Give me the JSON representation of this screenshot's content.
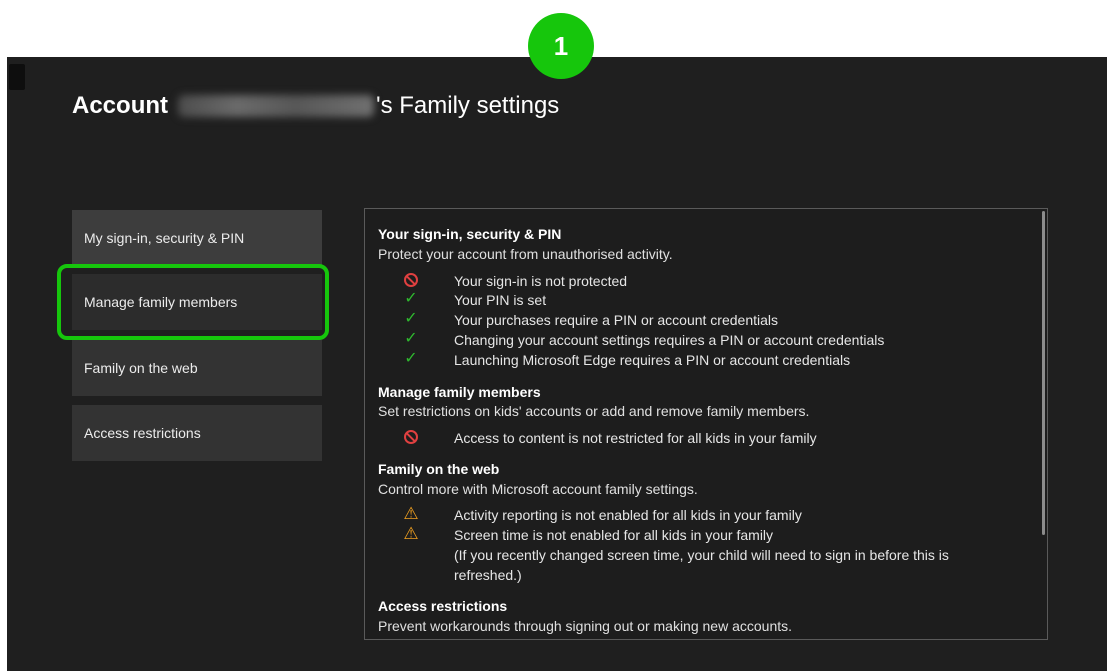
{
  "step_badge": "1",
  "title": {
    "prefix": "Account",
    "suffix": "'s Family settings"
  },
  "nav": [
    {
      "label": "My sign-in, security & PIN"
    },
    {
      "label": "Manage family members"
    },
    {
      "label": "Family on the web"
    },
    {
      "label": "Access restrictions"
    }
  ],
  "sections": {
    "signin": {
      "title": "Your sign-in, security & PIN",
      "desc": "Protect your account from unauthorised activity.",
      "items": [
        {
          "icon": "blocked-icon",
          "text": "Your sign-in is not protected"
        },
        {
          "icon": "check-icon",
          "text": "Your PIN is set"
        },
        {
          "icon": "check-icon",
          "text": "Your purchases require a PIN or account credentials"
        },
        {
          "icon": "check-icon",
          "text": "Changing your account settings requires a PIN or account credentials"
        },
        {
          "icon": "check-icon",
          "text": "Launching Microsoft Edge requires a PIN or account credentials"
        }
      ]
    },
    "family": {
      "title": "Manage family members",
      "desc": "Set restrictions on kids' accounts or add and remove family members.",
      "items": [
        {
          "icon": "blocked-icon",
          "text": "Access to content is not restricted for all kids in your family"
        }
      ]
    },
    "web": {
      "title": "Family on the web",
      "desc": "Control more with Microsoft account family settings.",
      "items": [
        {
          "icon": "warning-icon",
          "text": "Activity reporting is not enabled for all kids in your family"
        },
        {
          "icon": "warning-icon",
          "text": "Screen time is not enabled for all kids in your family\n(If you recently changed screen time, your child will need to sign in before this is refreshed.)"
        }
      ]
    },
    "access": {
      "title": "Access restrictions",
      "desc": "Prevent workarounds through signing out or making new accounts."
    }
  },
  "colors": {
    "accent": "#16c60c",
    "blocked": "#e04040",
    "check": "#2fb82f",
    "warning": "#f0a020",
    "background": "#1f1f1f"
  }
}
